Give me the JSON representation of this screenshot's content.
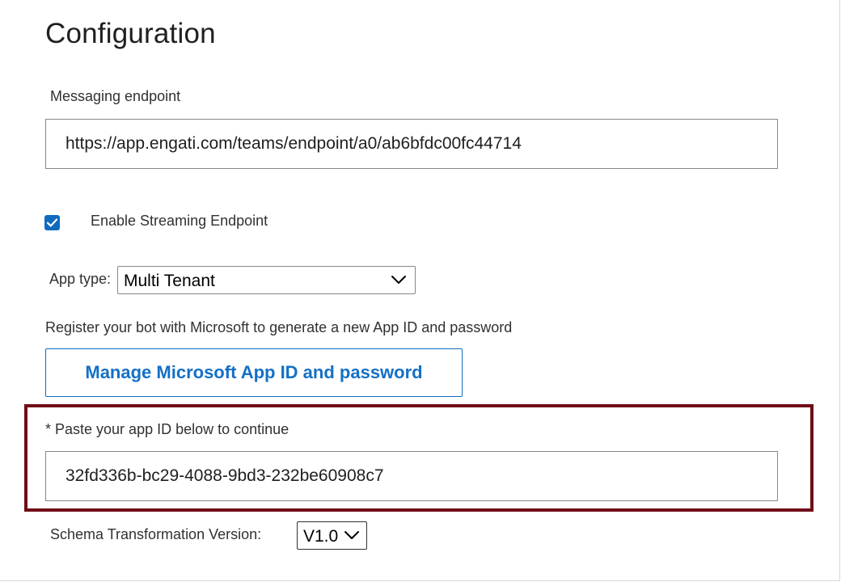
{
  "page": {
    "title": "Configuration"
  },
  "messaging_endpoint": {
    "label": "Messaging endpoint",
    "value": "https://app.engati.com/teams/endpoint/a0/ab6bfdc00fc44714"
  },
  "streaming": {
    "label": "Enable Streaming Endpoint",
    "checked": true
  },
  "app_type": {
    "label": "App type:",
    "selected": "Multi Tenant"
  },
  "register": {
    "text": "Register your bot with Microsoft to generate a new App ID and password",
    "button_label": "Manage Microsoft App ID and password"
  },
  "app_id": {
    "label": "* Paste your app ID below to continue",
    "value": "32fd336b-bc29-4088-9bd3-232be60908c7"
  },
  "schema": {
    "label": "Schema Transformation Version:",
    "selected": "V1.0"
  },
  "colors": {
    "accent": "#0f6cbd",
    "highlight_border": "#700d17"
  }
}
